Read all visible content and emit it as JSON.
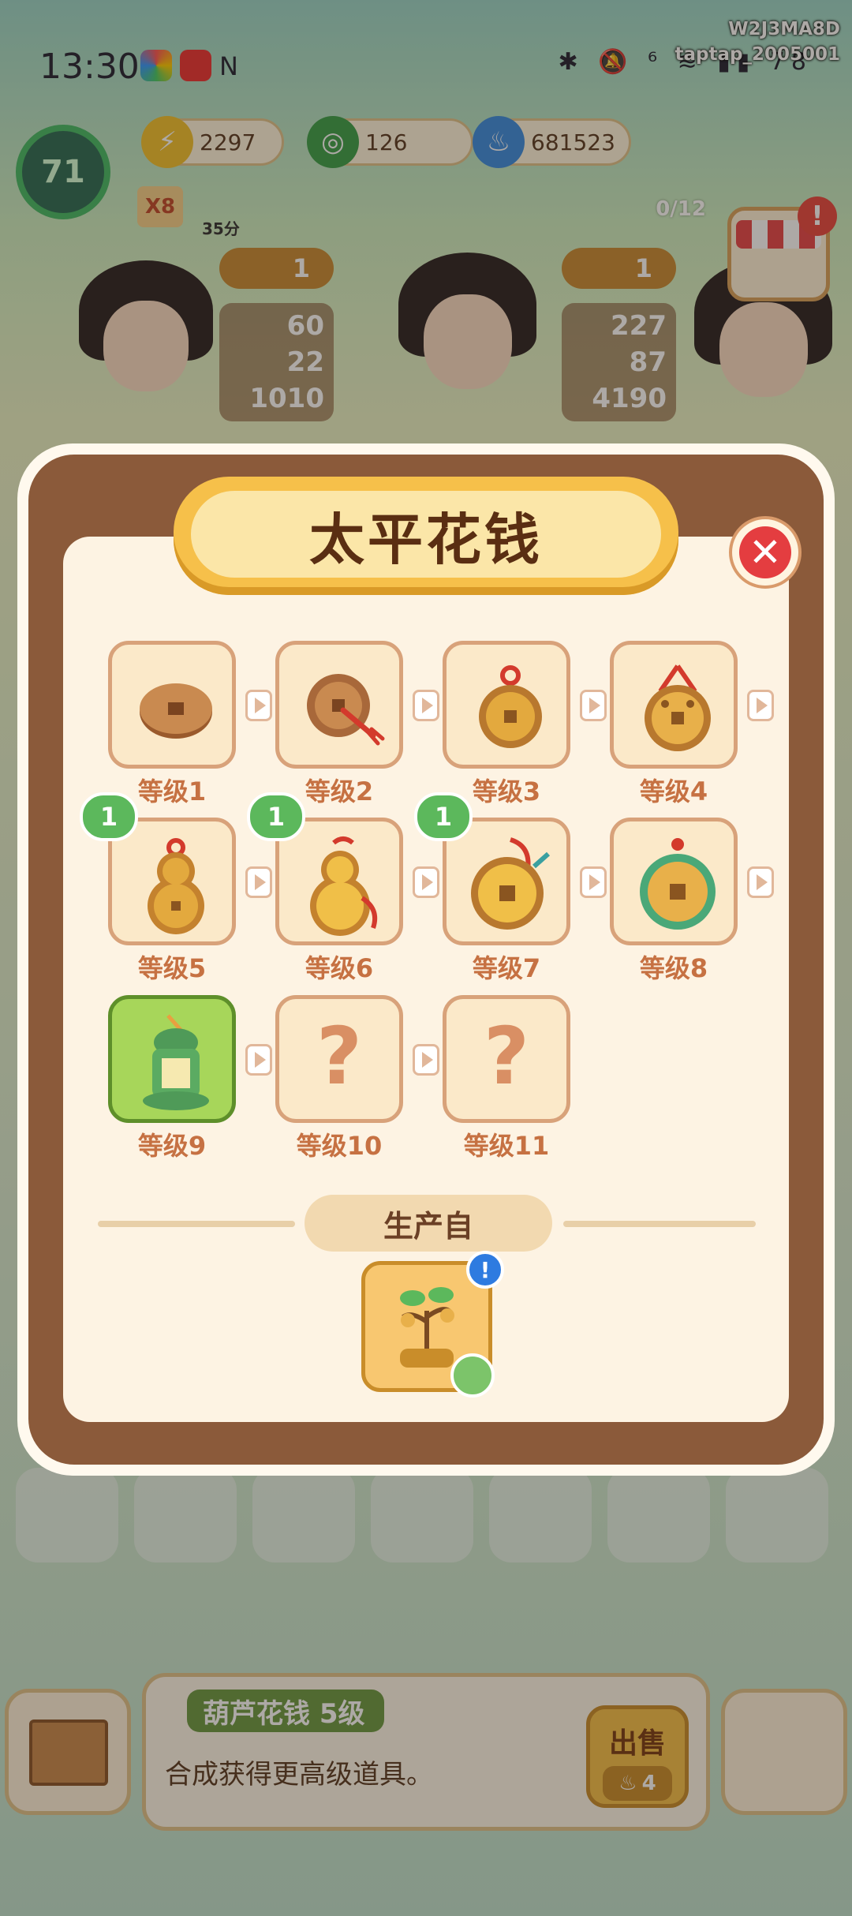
{
  "status_bar": {
    "time": "13:30",
    "battery": "78",
    "right_icons": "✱ 🔕 ⁶ ≋ ▮▮ "
  },
  "watermark": {
    "line1": "W2J3MA8D",
    "line2": "taptap_2005001"
  },
  "player": {
    "level": "71"
  },
  "resources": [
    {
      "icon": "bolt-icon",
      "value": "2297",
      "color": "#f2c22e"
    },
    {
      "icon": "jade-coin-icon",
      "value": "126",
      "color": "#3aa04a"
    },
    {
      "icon": "flame-icon",
      "value": "681523",
      "color": "#3b8de0"
    }
  ],
  "tags": {
    "multiplier": "X8",
    "timer": "35分"
  },
  "characters": [
    {
      "count": "1",
      "stats": [
        "60",
        "22",
        "1010"
      ]
    },
    {
      "count": "1",
      "stats": [
        "227",
        "87",
        "4190"
      ]
    }
  ],
  "shop": {
    "progress": "0/12",
    "alert": "!"
  },
  "modal": {
    "title": "太平花钱",
    "close": "✕",
    "levels": [
      {
        "label": "等级1",
        "badge": "",
        "state": "unlocked",
        "icon": "plain-coin"
      },
      {
        "label": "等级2",
        "badge": "",
        "state": "unlocked",
        "icon": "coin-tassel"
      },
      {
        "label": "等级3",
        "badge": "",
        "state": "unlocked",
        "icon": "coin-knot"
      },
      {
        "label": "等级4",
        "badge": "",
        "state": "unlocked",
        "icon": "coin-ornate"
      },
      {
        "label": "等级5",
        "badge": "1",
        "state": "unlocked",
        "icon": "gourd-coin"
      },
      {
        "label": "等级6",
        "badge": "1",
        "state": "unlocked",
        "icon": "gourd-fortune"
      },
      {
        "label": "等级7",
        "badge": "1",
        "state": "unlocked",
        "icon": "big-coin"
      },
      {
        "label": "等级8",
        "badge": "",
        "state": "unlocked",
        "icon": "jade-coin"
      },
      {
        "label": "等级9",
        "badge": "",
        "state": "current",
        "icon": "jade-plaque"
      },
      {
        "label": "等级10",
        "badge": "",
        "state": "locked",
        "icon": "question"
      },
      {
        "label": "等级11",
        "badge": "",
        "state": "locked",
        "icon": "question"
      }
    ],
    "locked_symbol": "?",
    "produced_from_label": "生产自",
    "producer": {
      "icon": "money-tree-icon",
      "alert": "!"
    }
  },
  "bottom": {
    "item_title": "葫芦花钱 5级",
    "item_desc": "合成获得更高级道具。",
    "sell_label": "出售",
    "sell_price": "4"
  }
}
